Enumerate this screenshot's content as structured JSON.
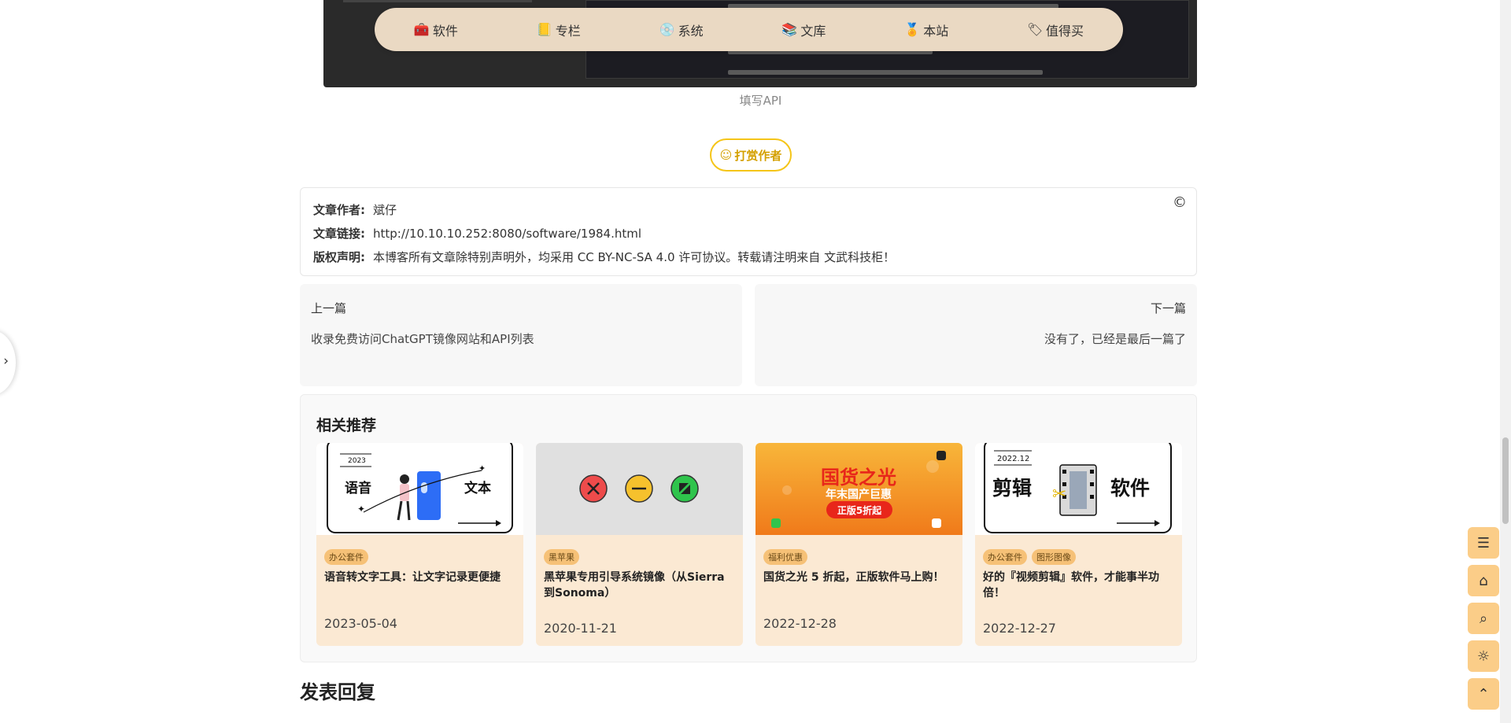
{
  "topnav": {
    "items": [
      {
        "label": "软件",
        "icon": "toolbox-icon",
        "glyph": "🧰"
      },
      {
        "label": "专栏",
        "icon": "notebook-icon",
        "glyph": "📒"
      },
      {
        "label": "系统",
        "icon": "disc-icon",
        "glyph": "💿"
      },
      {
        "label": "文库",
        "icon": "books-icon",
        "glyph": "📚"
      },
      {
        "label": "本站",
        "icon": "medal-icon",
        "glyph": "🏅"
      },
      {
        "label": "值得买",
        "icon": "tag-icon",
        "glyph": "🏷"
      }
    ]
  },
  "hero": {
    "caption": "填写API"
  },
  "reward": {
    "label": "打赏作者",
    "icon_glyph": "☺"
  },
  "copyright": {
    "author_label": "文章作者:",
    "author": "斌仔",
    "link_label": "文章链接:",
    "link": "http://10.10.10.252:8080/software/1984.html",
    "license_label": "版权声明:",
    "license": "本博客所有文章除特别声明外，均采用 CC BY-NC-SA 4.0 许可协议。转载请注明来自 文武科技柜！",
    "cc_glyph": "©"
  },
  "postnav": {
    "prev_label": "上一篇",
    "prev_title": "收录免费访问ChatGPT镜像网站和API列表",
    "next_label": "下一篇",
    "next_title": "没有了，已经是最后一篇了"
  },
  "related": {
    "heading": "相关推荐",
    "cards": [
      {
        "tags": [
          "办公套件"
        ],
        "title": "语音转文字工具：让文字记录更便捷",
        "date": "2023-05-04",
        "thumb_year": "2023",
        "thumb_left": "语音",
        "thumb_right": "文本"
      },
      {
        "tags": [
          "黑苹果"
        ],
        "title": "黑苹果专用引导系统镜像（从Sierra到Sonoma）",
        "date": "2020-11-21"
      },
      {
        "tags": [
          "福利优惠"
        ],
        "title": "国货之光 5 折起，正版软件马上购！",
        "date": "2022-12-28",
        "thumb_main": "国货之光",
        "thumb_sub": "年末国产巨惠",
        "thumb_badge": "正版5折起"
      },
      {
        "tags": [
          "办公套件",
          "图形图像"
        ],
        "title": "好的『视频剪辑』软件，才能事半功倍！",
        "date": "2022-12-27",
        "thumb_year": "2022.12",
        "thumb_left": "剪辑",
        "thumb_right": "软件"
      }
    ]
  },
  "reply": {
    "heading": "发表回复"
  },
  "side": {
    "toggle_glyph": "›"
  },
  "fabs": [
    {
      "name": "toc-button",
      "glyph": "☰"
    },
    {
      "name": "home-button",
      "glyph": "⌂"
    },
    {
      "name": "search-button",
      "glyph": "⌕"
    },
    {
      "name": "theme-button",
      "glyph": "☼"
    },
    {
      "name": "back-to-top-button",
      "glyph": "⌃"
    }
  ],
  "colors": {
    "nav_bg": "#ead9c3",
    "card_bg": "#fbe9d3",
    "tag_bg": "#f6c177",
    "fab_bg": "#fbcd88",
    "reward_border": "#f5c518"
  }
}
